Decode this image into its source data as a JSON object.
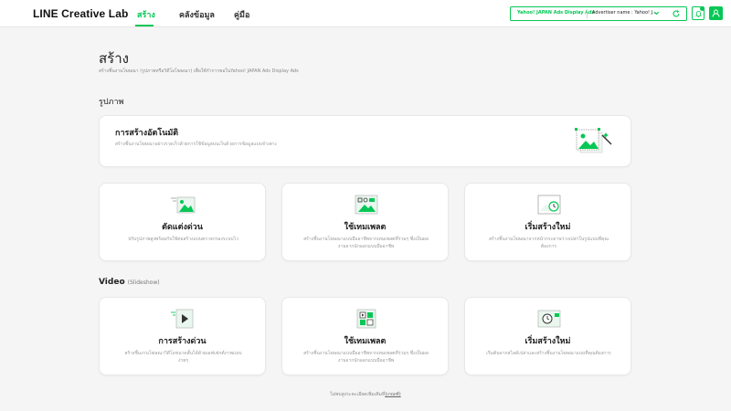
{
  "header": {
    "logo": "LINE Creative Lab",
    "nav": [
      {
        "label": "สร้าง",
        "active": true
      },
      {
        "label": "คลังข้อมูล",
        "active": false
      },
      {
        "label": "คู่มือ",
        "active": false
      }
    ],
    "advertiser": {
      "product": "Yahoo! JAPAN Ads Display Ads",
      "name": "Advertiser name : Yahoo! J..."
    }
  },
  "page": {
    "title": "สร้าง",
    "subtitle": "สร้างชิ้นงานโฆษณา (รูปภาพหรือวิดีโอโฆษณา) เพื่อใช้กำการขอในYahoo! JAPAN Ads Display Ads"
  },
  "image_section": {
    "title": "รูปภาพ",
    "auto_card": {
      "title": "การสร้างอัตโนมัติ",
      "desc": "สร้างชิ้นงานโฆษณาอย่างรวดเร็วด้วยการใช้ข้อมูลบนเว็บด้วยการข้อมูลแบบจำเพาะ",
      "icon": "auto-create-image-icon"
    },
    "cards": [
      {
        "title": "ตัดแต่งด่วน",
        "desc": "ปรับรูปภาพสูงพร้อมกับใช้ต่อสร้างแบบตรวจกรองระบบไว",
        "icon": "quick-edit-image-icon"
      },
      {
        "title": "ใช้เทมเพลต",
        "desc": "สร้างชิ้นงานโฆษณาแบบมืออาชีพจากเทมเพลตที่ร่วมๆ ซึ่งเป็นผลงานจากนักออกแบบมืออาชีพ",
        "icon": "template-image-icon"
      },
      {
        "title": "เริ่มสร้างใหม่",
        "desc": "สร้างชิ้นงานโฆษณาจากหน้ากระดาษว่างเปล่าในรูปแบบที่คุณต้องการ",
        "icon": "new-canvas-image-icon"
      }
    ]
  },
  "video_section": {
    "title": "Video",
    "subtitle": "(Slideshow)",
    "cards": [
      {
        "title": "การสร้างด่วน",
        "desc": "สร้างชิ้นงานโฆษณาวิดีโอขนาดสั้นได้ด้วยเอฟเฟกต์ภาพแบบง่ายๆ",
        "icon": "quick-create-video-icon"
      },
      {
        "title": "ใช้เทมเพลต",
        "desc": "สร้างชิ้นงานโฆษณาแบบมืออาชีพจากเทมเพลตที่ร่วมๆ ซึ่งเป็นผลงานจากนักออกแบบมืออาชีพ",
        "icon": "template-video-icon"
      },
      {
        "title": "เริ่มสร้างใหม่",
        "desc": "เริ่มต้นจากสไลด์เปล่าและสร้างชิ้นงานโฆษณาแบบที่คุณต้องการ",
        "icon": "new-canvas-video-icon"
      }
    ]
  },
  "footer": {
    "text": "ไม่พบสูงระคะเอียดเพิ่มเติมที่",
    "link": "(เกณฑ์)"
  },
  "colors": {
    "accent": "#06c755",
    "background": "#f5f5f5"
  }
}
